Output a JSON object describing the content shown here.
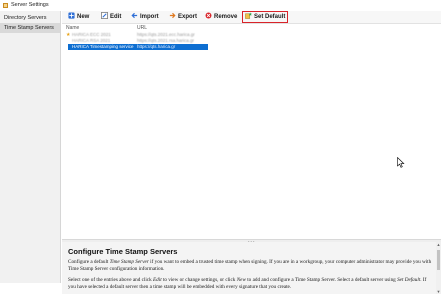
{
  "window": {
    "title": "Server Settings"
  },
  "sidebar": {
    "items": [
      {
        "label": "Directory Servers",
        "active": false
      },
      {
        "label": "Time Stamp Servers",
        "active": true
      }
    ]
  },
  "toolbar": {
    "new_label": "New",
    "edit_label": "Edit",
    "import_label": "Import",
    "export_label": "Export",
    "remove_label": "Remove",
    "set_default_label": "Set Default"
  },
  "table": {
    "headers": {
      "name": "Name",
      "url": "URL"
    },
    "rows": [
      {
        "name": "HARICA ECC 2021",
        "url": "https://qts.2021.ecc.harica.gr",
        "default": true,
        "selected": false
      },
      {
        "name": "HARICA RSA 2021",
        "url": "https://qts.2021.rsa.harica.gr",
        "default": false,
        "selected": false
      },
      {
        "name": "HARICA Timestamping service",
        "url": "https://qts.harica.gr",
        "default": false,
        "selected": true
      }
    ]
  },
  "help": {
    "title": "Configure Time Stamp Servers",
    "p1_a": "Configure a default ",
    "p1_em": "Time Stamp Server",
    "p1_b": " if you want to embed a trusted time stamp when signing. If you are in a workgroup, your computer administrator may provide you with Time Stamp Server configuration information.",
    "p2_a": "Select one of the entries above and click ",
    "p2_em1": "Edit",
    "p2_b": " to view or change settings, or click ",
    "p2_em2": "New",
    "p2_c": " to add and configure a Time Stamp Server. Select a default server using ",
    "p2_em3": "Set Default",
    "p2_d": ". If you have selected a default server then a time stamp will be embedded with every signature that you create."
  },
  "colors": {
    "selection": "#0d6ed1",
    "highlight_box": "#d9232a",
    "default_star": "#e8a317"
  }
}
